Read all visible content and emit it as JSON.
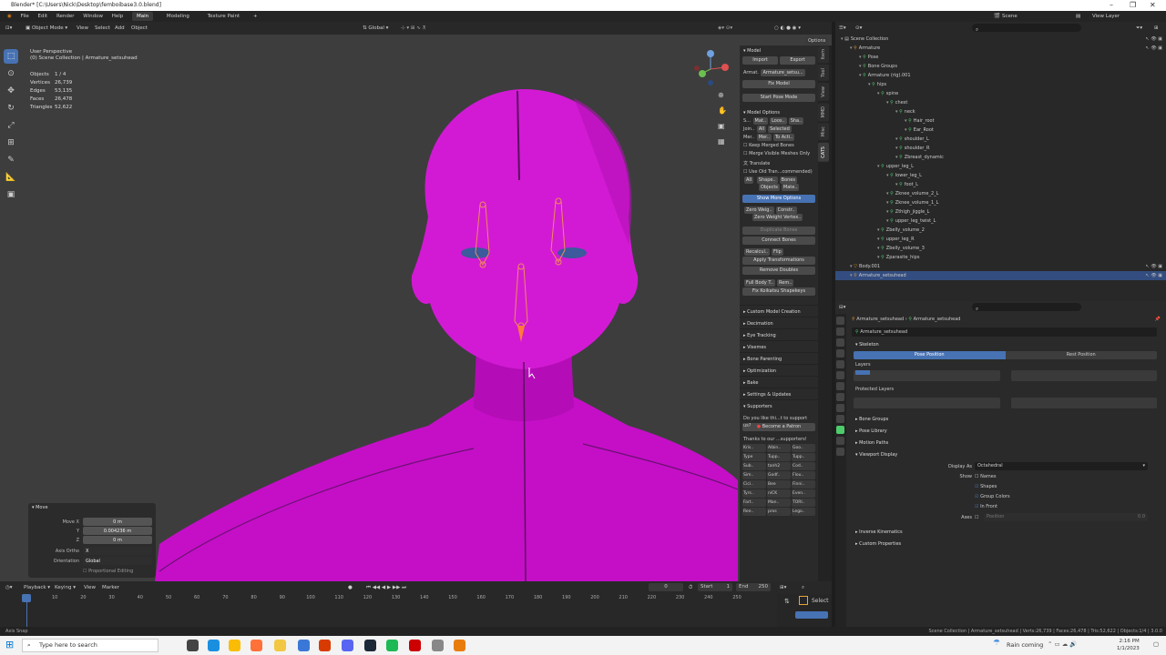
{
  "window": {
    "title": "Blender* [C:\\Users\\Nick\\Desktop\\femboibase3.0.blend]"
  },
  "menu": {
    "items": [
      "File",
      "Edit",
      "Render",
      "Window",
      "Help"
    ],
    "workspaces": [
      "Main",
      "Modeling",
      "Texture Paint"
    ]
  },
  "viewport_header": {
    "mode": "Object Mode",
    "menus": [
      "View",
      "Select",
      "Add",
      "Object"
    ],
    "transform": "Global",
    "options": "Options"
  },
  "overlay": {
    "perspective": "User Perspective",
    "collection": "(0) Scene Collection | Armature_setsuhead",
    "stats": [
      {
        "label": "Objects",
        "value": "1 / 4"
      },
      {
        "label": "Vertices",
        "value": "26,739"
      },
      {
        "label": "Edges",
        "value": "53,135"
      },
      {
        "label": "Faces",
        "value": "26,478"
      },
      {
        "label": "Triangles",
        "value": "52,622"
      }
    ]
  },
  "move_panel": {
    "title": "Move",
    "move_x_label": "Move X",
    "move_x": "0 m",
    "y_label": "Y",
    "y": "0.004236 m",
    "z_label": "Z",
    "z": "0 m",
    "axis_ortho_label": "Axis Ortho",
    "axis_ortho": "X",
    "orientation_label": "Orientation",
    "orientation": "Global",
    "proportional": "Proportional Editing"
  },
  "npanel": {
    "model_header": "Model",
    "import": "Import",
    "export": "Export",
    "armature_label": "Armat.",
    "armature_value": "Armature_setsu...",
    "fix_model": "Fix Model",
    "start_pose": "Start Pose Mode",
    "model_options": "Model Options",
    "opt1": "S...",
    "opt1_btns": [
      "Mat..",
      "Loos..",
      "Sha.."
    ],
    "joins": "Join..",
    "joins_btns": [
      "All",
      "Selected"
    ],
    "mer": "Mer..",
    "mer_btns": [
      "Mer..",
      "To Acti.."
    ],
    "keep_merged": "Keep Merged Bones",
    "merge_visible": "Merge Visible Meshes Only",
    "translate": "Translate",
    "use_old": "Use Old Tran...commended)",
    "all": "All",
    "row_a": [
      "Shape..",
      "Bones"
    ],
    "row_b": [
      "Objects",
      "Mate.."
    ],
    "show_more": "Show More Options",
    "zero_weight": "Zero Weig..",
    "constr": "Constr..",
    "zero_weight_vertex": "Zero Weight Vertex..",
    "duplicate_bones": "Duplicate Bones",
    "connect_bones": "Connect Bones",
    "recalc": "Recalcul..",
    "flip": "Flip",
    "apply_transforms": "Apply Transformations",
    "remove_doubles": "Remove Doubles",
    "full_body": "Full Body T..",
    "rem": "Rem..",
    "fix_koikatsu": "Fix Koikatsu Shapekeys",
    "sections": [
      "Custom Model Creation",
      "Decimation",
      "Eye Tracking",
      "Visemes",
      "Bone Parenting",
      "Optimization",
      "Bake",
      "Settings & Updates",
      "Supporters"
    ],
    "do_you_like": "Do you like thi...t to support us?",
    "become_patron": "Become a Patron",
    "thanks": "Thanks to our ...supporters! <3",
    "supporters": [
      "Kris..",
      "Albin..",
      "Goo..",
      "Type",
      "Tupp..",
      "Tupp..",
      "Sub..",
      "tanh2",
      "Cod..",
      "Sim..",
      "Godf..",
      "Flou..",
      "Cici..",
      "Bee",
      "Finni..",
      "Tyrs..",
      "niCK",
      "Even..",
      "Fart..",
      "Man..",
      "TORI..",
      "Ree..",
      "pros",
      "Lego.."
    ]
  },
  "ntabs": [
    "Item",
    "Tool",
    "View",
    "MMD",
    "Misc",
    "CATS"
  ],
  "timeline": {
    "menus": [
      "Playback",
      "Keying",
      "View",
      "Marker"
    ],
    "current": "0",
    "start_label": "Start",
    "start": "1",
    "end_label": "End",
    "end": "250",
    "ticks": [
      "0",
      "10",
      "20",
      "30",
      "40",
      "50",
      "60",
      "70",
      "80",
      "90",
      "100",
      "110",
      "120",
      "130",
      "140",
      "150",
      "160",
      "170",
      "180",
      "190",
      "200",
      "210",
      "220",
      "230",
      "240",
      "250"
    ],
    "select": "Select"
  },
  "outliner": {
    "scene": "Scene",
    "view_layer": "View Layer",
    "items": [
      {
        "depth": 0,
        "label": "Scene Collection",
        "icon": "collection-icon"
      },
      {
        "depth": 1,
        "label": "Armature",
        "icon": "armature-icon"
      },
      {
        "depth": 2,
        "label": "Pose",
        "icon": "pose-icon"
      },
      {
        "depth": 2,
        "label": "Bone Groups",
        "icon": "bone-group-icon"
      },
      {
        "depth": 2,
        "label": "Armature (rig).001",
        "icon": "armature-data-icon"
      },
      {
        "depth": 3,
        "label": "hips",
        "icon": "bone-icon"
      },
      {
        "depth": 4,
        "label": "spine",
        "icon": "bone-icon"
      },
      {
        "depth": 5,
        "label": "chest",
        "icon": "bone-icon"
      },
      {
        "depth": 6,
        "label": "neck",
        "icon": "bone-icon"
      },
      {
        "depth": 7,
        "label": "Hair_root",
        "icon": "bone-icon"
      },
      {
        "depth": 7,
        "label": "Ear_Root",
        "icon": "bone-icon"
      },
      {
        "depth": 6,
        "label": "shoulder_L",
        "icon": "bone-icon"
      },
      {
        "depth": 6,
        "label": "shoulder_R",
        "icon": "bone-icon"
      },
      {
        "depth": 6,
        "label": "Zbreast_dynamic",
        "icon": "bone-icon"
      },
      {
        "depth": 4,
        "label": "upper_leg_L",
        "icon": "bone-icon"
      },
      {
        "depth": 5,
        "label": "lower_leg_L",
        "icon": "bone-icon"
      },
      {
        "depth": 6,
        "label": "foot_L",
        "icon": "bone-icon"
      },
      {
        "depth": 5,
        "label": "Zknee_volume_2_L",
        "icon": "bone-icon"
      },
      {
        "depth": 5,
        "label": "Zknee_volume_1_L",
        "icon": "bone-icon"
      },
      {
        "depth": 5,
        "label": "Zthigh_jiggle_L",
        "icon": "bone-icon"
      },
      {
        "depth": 5,
        "label": "upper_leg_twist_L",
        "icon": "bone-icon"
      },
      {
        "depth": 4,
        "label": "Zbelly_volume_2",
        "icon": "bone-icon"
      },
      {
        "depth": 4,
        "label": "upper_leg_R",
        "icon": "bone-icon"
      },
      {
        "depth": 4,
        "label": "Zbelly_volume_3",
        "icon": "bone-icon"
      },
      {
        "depth": 4,
        "label": "Zparasite_hips",
        "icon": "bone-icon"
      },
      {
        "depth": 1,
        "label": "Body.001",
        "icon": "mesh-icon"
      },
      {
        "depth": 1,
        "label": "Armature_setsuhead",
        "icon": "armature-icon",
        "selected": true
      }
    ]
  },
  "props": {
    "breadcrumb_a": "Armature_setsuhead",
    "breadcrumb_b": "Armature_setsuhead",
    "datablock": "Armature_setsuhead",
    "skeleton": "Skeleton",
    "pose_position": "Pose Position",
    "rest_position": "Rest Position",
    "layers": "Layers",
    "protected_layers": "Protected Layers",
    "bone_groups": "Bone Groups",
    "pose_library": "Pose Library",
    "motion_paths": "Motion Paths",
    "viewport_display": "Viewport Display",
    "display_as_label": "Display As",
    "display_as": "Octahedral",
    "show_label": "Show",
    "names": "Names",
    "shapes": "Shapes",
    "group_colors": "Group Colors",
    "in_front": "In Front",
    "axes_label": "Axes",
    "position": "Position",
    "position_val": "0.0",
    "inverse_kinematics": "Inverse Kinematics",
    "custom_properties": "Custom Properties"
  },
  "statusbar": {
    "left": "Axis Snap",
    "right": "Scene Collection | Armature_setsuhead | Verts:26,739 | Faces:26,478 | Tris:52,622 | Objects:1/4 | 3.0.0"
  },
  "taskbar": {
    "search": "Type here to search",
    "weather": "Rain coming",
    "time": "2:16 PM",
    "date": "1/1/2023"
  },
  "colors": {
    "accent": "#4772b3",
    "skin": "#c914c9",
    "bone": "#f08a5d",
    "outliner_green": "#4ecc6c"
  }
}
